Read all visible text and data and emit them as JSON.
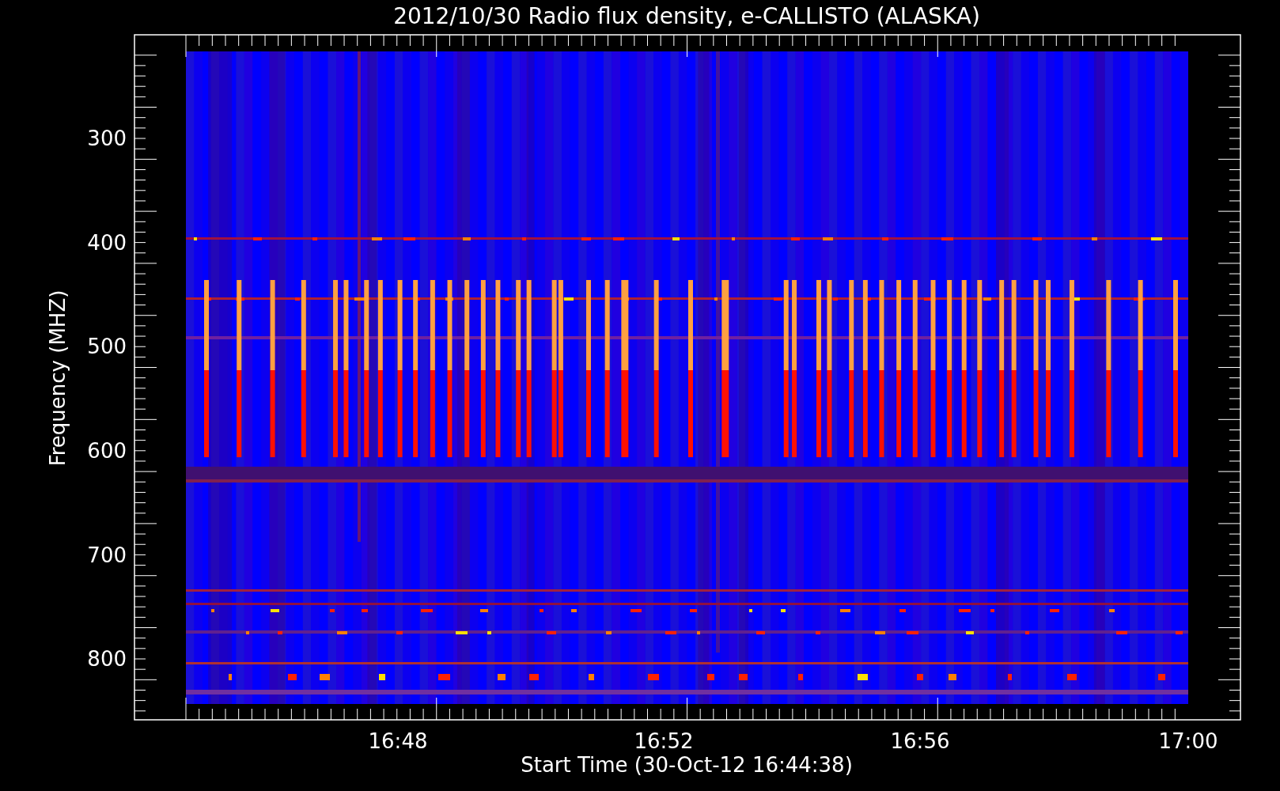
{
  "title": "2012/10/30  Radio flux density, e-CALLISTO (ALASKA)",
  "y_axis": {
    "label": "Frequency (MHZ)",
    "ticks": [
      "300",
      "400",
      "500",
      "600",
      "700",
      "800"
    ]
  },
  "x_axis": {
    "label": "Start Time (30-Oct-12 16:44:38)",
    "ticks": [
      "16:48",
      "16:52",
      "16:56",
      "17:00"
    ]
  }
}
